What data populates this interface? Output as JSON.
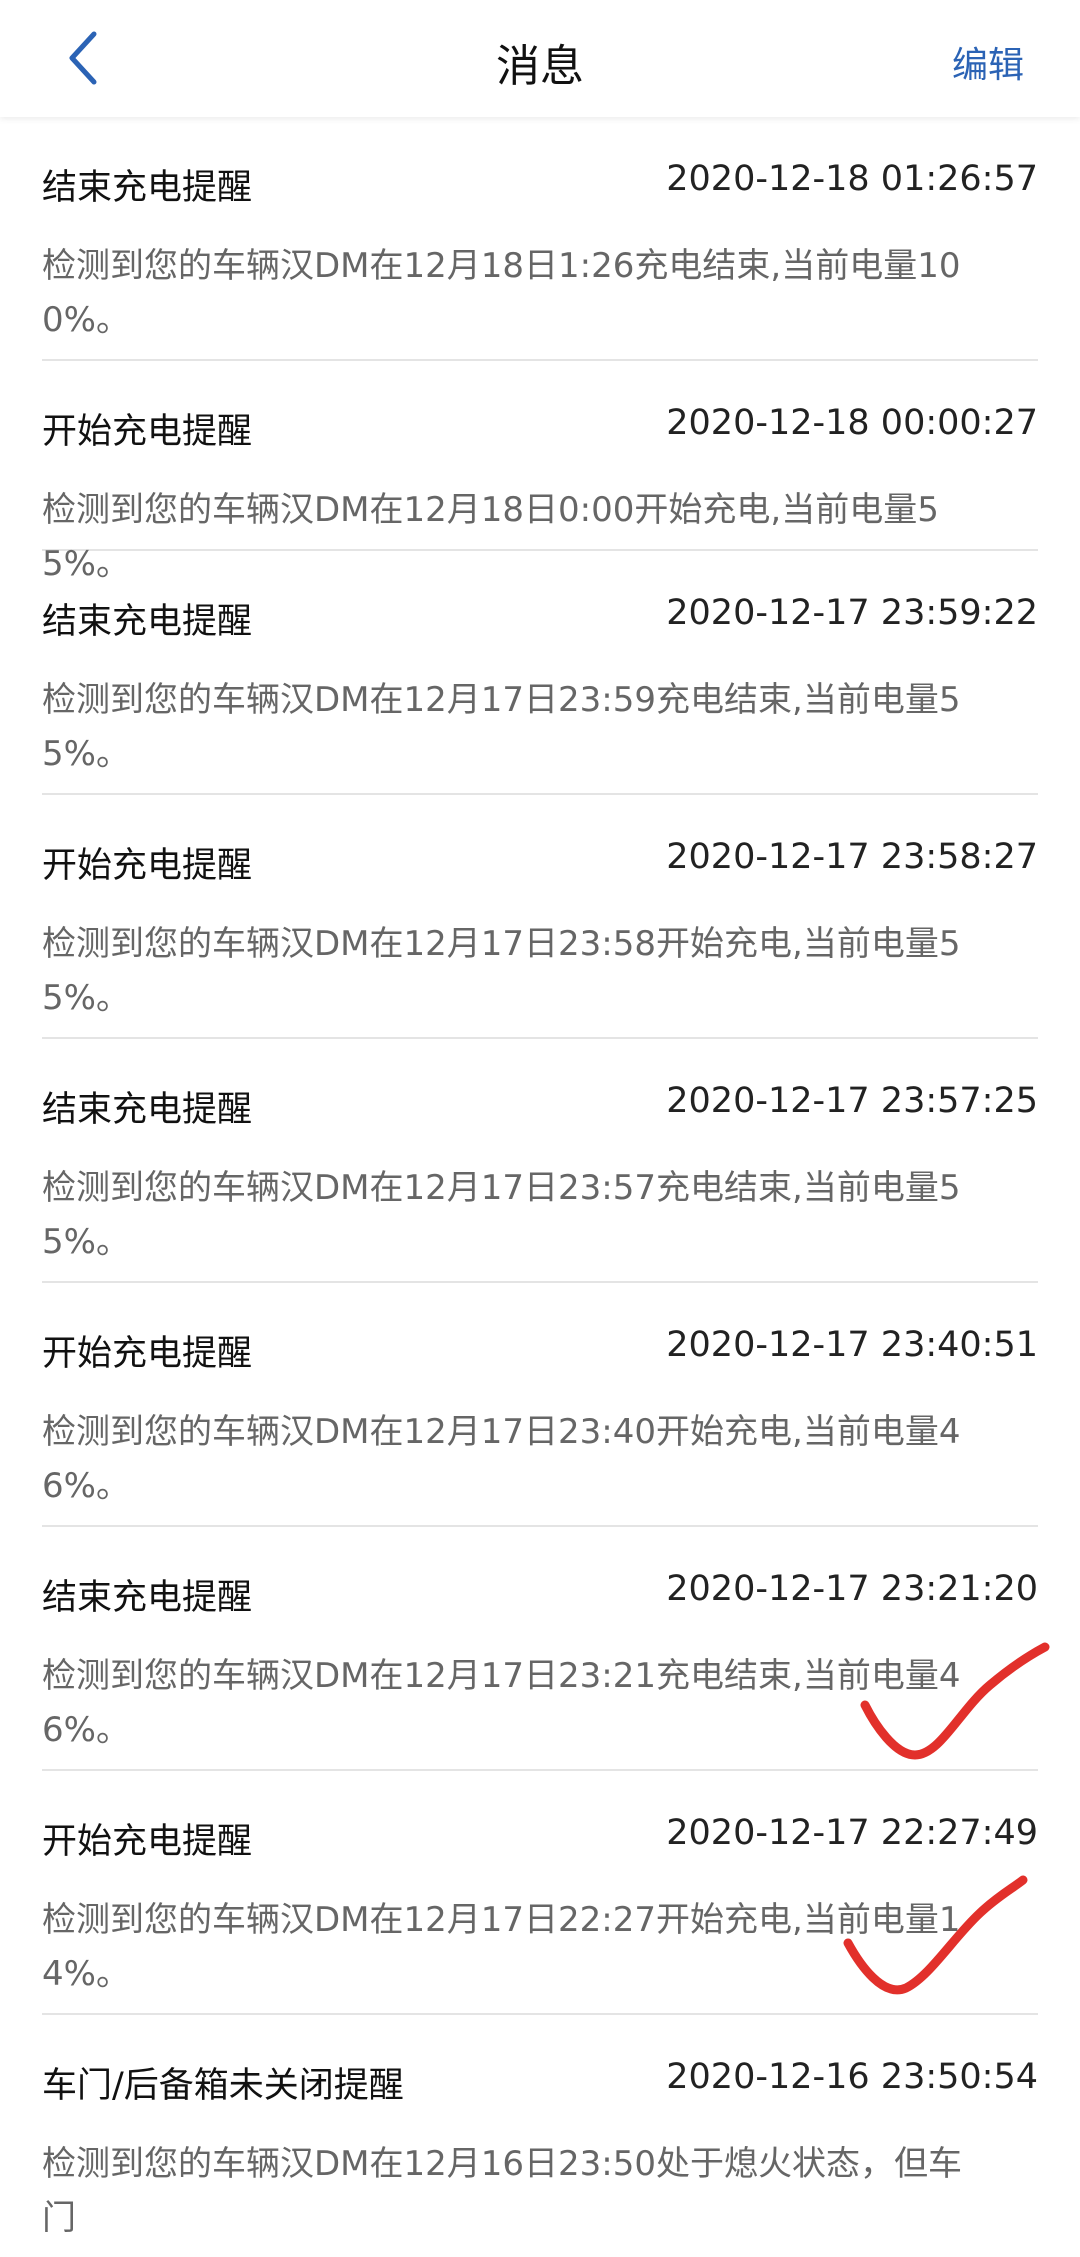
{
  "header": {
    "title": "消息",
    "edit_label": "编辑",
    "back_icon": "chevron-left-icon",
    "accent_color": "#2b63b5"
  },
  "messages": [
    {
      "title": "结束充电提醒",
      "time": "2020-12-18 01:26:57",
      "body": "检测到您的车辆汉DM在12月18日1:26充电结束,当前电量100%。"
    },
    {
      "title": "开始充电提醒",
      "time": "2020-12-18 00:00:27",
      "body": "检测到您的车辆汉DM在12月18日0:00开始充电,当前电量55%。"
    },
    {
      "title": "结束充电提醒",
      "time": "2020-12-17 23:59:22",
      "body": "检测到您的车辆汉DM在12月17日23:59充电结束,当前电量55%。"
    },
    {
      "title": "开始充电提醒",
      "time": "2020-12-17 23:58:27",
      "body": "检测到您的车辆汉DM在12月17日23:58开始充电,当前电量55%。"
    },
    {
      "title": "结束充电提醒",
      "time": "2020-12-17 23:57:25",
      "body": "检测到您的车辆汉DM在12月17日23:57充电结束,当前电量55%。"
    },
    {
      "title": "开始充电提醒",
      "time": "2020-12-17 23:40:51",
      "body": "检测到您的车辆汉DM在12月17日23:40开始充电,当前电量46%。"
    },
    {
      "title": "结束充电提醒",
      "time": "2020-12-17 23:21:20",
      "body": "检测到您的车辆汉DM在12月17日23:21充电结束,当前电量46%。"
    },
    {
      "title": "开始充电提醒",
      "time": "2020-12-17 22:27:49",
      "body": "检测到您的车辆汉DM在12月17日22:27开始充电,当前电量14%。"
    },
    {
      "title": "车门/后备箱未关闭提醒",
      "time": "2020-12-16 23:50:54",
      "body": "检测到您的车辆汉DM在12月16日23:50处于熄火状态，但车门"
    }
  ],
  "annotation_color": "#e2302b"
}
